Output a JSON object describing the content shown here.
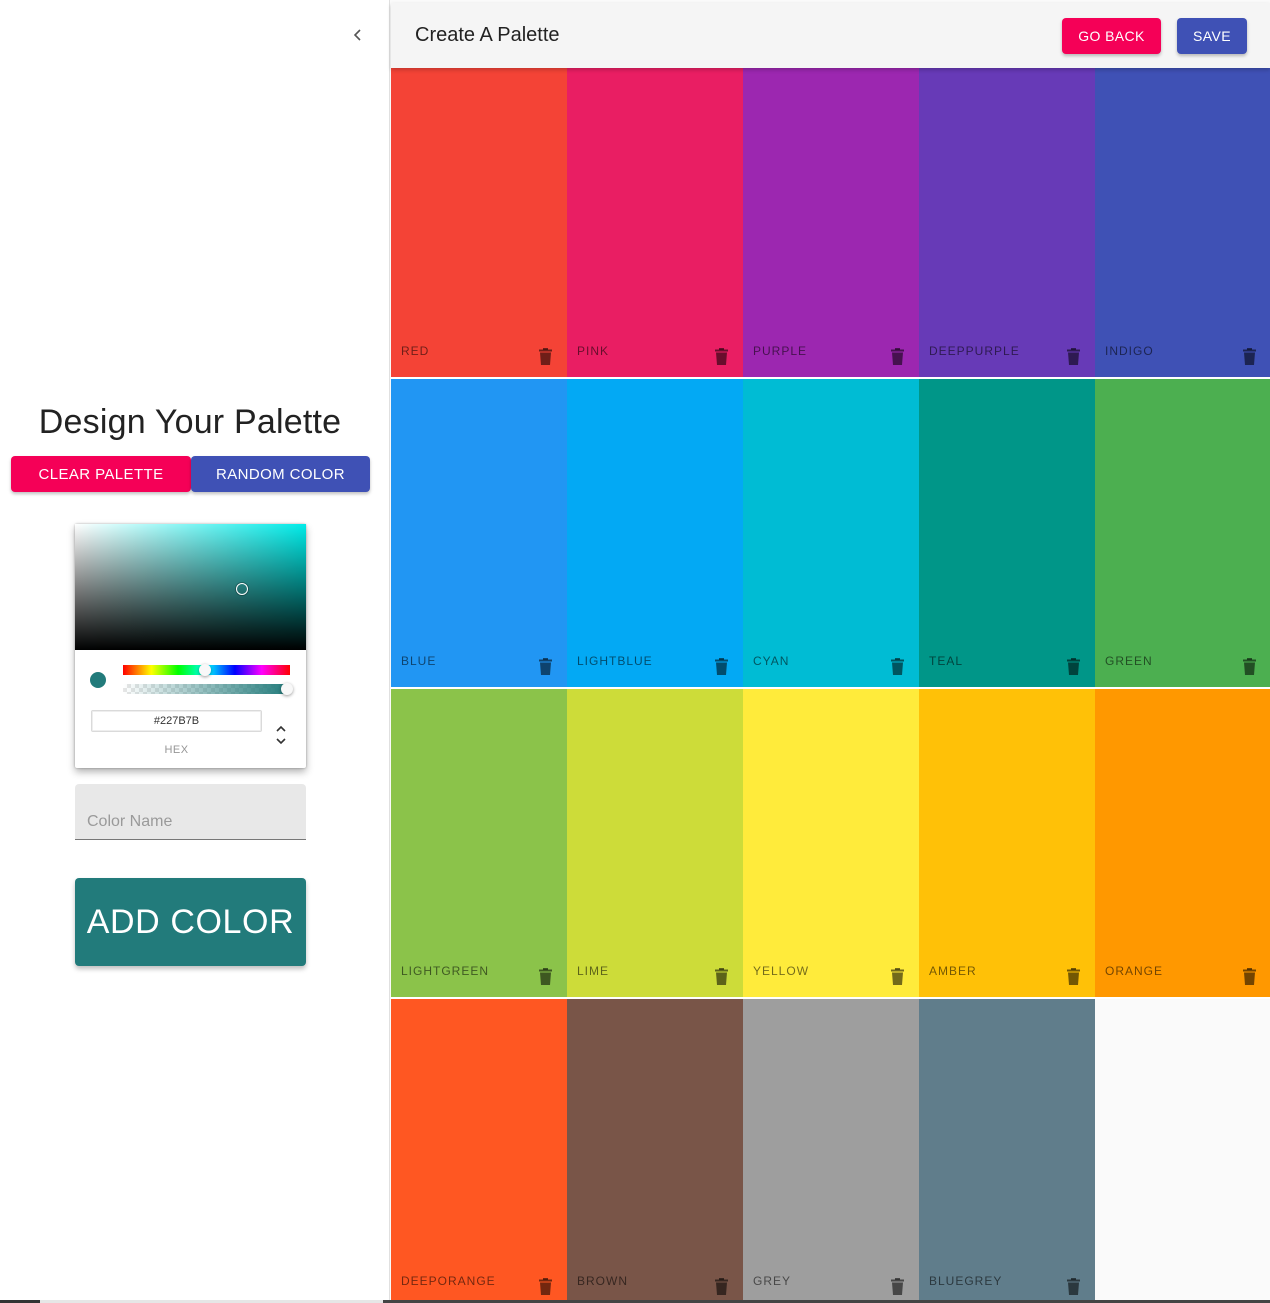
{
  "drawer": {
    "collapse_icon": "chevron-left-icon",
    "title": "Design Your Palette",
    "clear_label": "CLEAR PALETTE",
    "random_label": "RANDOM COLOR",
    "picker": {
      "hex_value": "#227B7B",
      "hex_label": "HEX",
      "current_color": "#227b7b"
    },
    "color_name_placeholder": "Color Name",
    "add_label": "ADD COLOR",
    "add_color": "#227b7b"
  },
  "appbar": {
    "title": "Create A Palette",
    "back_label": "GO BACK",
    "save_label": "SAVE"
  },
  "palette": [
    {
      "name": "red",
      "color": "#f44336"
    },
    {
      "name": "pink",
      "color": "#e91e63"
    },
    {
      "name": "purple",
      "color": "#9c27b0"
    },
    {
      "name": "deeppurple",
      "color": "#673ab7"
    },
    {
      "name": "indigo",
      "color": "#3f51b5"
    },
    {
      "name": "blue",
      "color": "#2196f3"
    },
    {
      "name": "lightblue",
      "color": "#03a9f4"
    },
    {
      "name": "cyan",
      "color": "#00bcd4"
    },
    {
      "name": "teal",
      "color": "#009688"
    },
    {
      "name": "green",
      "color": "#4caf50"
    },
    {
      "name": "lightgreen",
      "color": "#8bc34a"
    },
    {
      "name": "lime",
      "color": "#cddc39"
    },
    {
      "name": "yellow",
      "color": "#ffeb3b"
    },
    {
      "name": "amber",
      "color": "#ffc107"
    },
    {
      "name": "orange",
      "color": "#ff9800"
    },
    {
      "name": "deeporange",
      "color": "#ff5722"
    },
    {
      "name": "brown",
      "color": "#795548"
    },
    {
      "name": "grey",
      "color": "#9e9e9e"
    },
    {
      "name": "bluegrey",
      "color": "#607d8b"
    }
  ]
}
